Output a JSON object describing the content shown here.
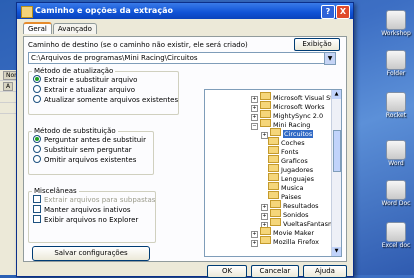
{
  "dialog": {
    "title": "Caminho e opções da extração",
    "help_button": "?",
    "close_button": "X"
  },
  "tabs": [
    {
      "label": "Geral",
      "active": true
    },
    {
      "label": "Avançado",
      "active": false
    }
  ],
  "destination": {
    "label": "Caminho de destino (se o caminho não existir, ele será criado)",
    "value": "C:\\Arquivos de programas\\Mini Racing\\Circuitos",
    "explore_button": "Exibição"
  },
  "update_method": {
    "title": "Método de atualização",
    "options": [
      {
        "label": "Extrair e substituir arquivo",
        "selected": true
      },
      {
        "label": "Extrair e atualizar arquivo",
        "selected": false
      },
      {
        "label": "Atualizar somente arquivos existentes",
        "selected": false
      }
    ]
  },
  "overwrite_mode": {
    "title": "Método de substituição",
    "options": [
      {
        "label": "Perguntar antes de substituir",
        "selected": true
      },
      {
        "label": "Substituir sem perguntar",
        "selected": false
      },
      {
        "label": "Omitir arquivos existentes",
        "selected": false
      }
    ]
  },
  "misc": {
    "title": "Miscelâneas",
    "options": [
      {
        "label": "Extrair arquivos para subpastas",
        "checked": false,
        "disabled": true
      },
      {
        "label": "Manter arquivos inativos",
        "checked": false,
        "disabled": false
      },
      {
        "label": "Exibir arquivos no Explorer",
        "checked": false,
        "disabled": false
      }
    ],
    "save_button": "Salvar configurações"
  },
  "tree": {
    "items": [
      {
        "label": "Microsoft Visual Studio",
        "expandable": true,
        "depth": 0
      },
      {
        "label": "Microsoft Works",
        "expandable": true,
        "depth": 0
      },
      {
        "label": "MightySync 2.0",
        "expandable": true,
        "depth": 0
      },
      {
        "label": "Mini Racing",
        "expandable": true,
        "depth": 0
      },
      {
        "label": "Circuitos",
        "expandable": true,
        "depth": 1,
        "selected": true
      },
      {
        "label": "Coches",
        "expandable": false,
        "depth": 1
      },
      {
        "label": "Fonts",
        "expandable": false,
        "depth": 1
      },
      {
        "label": "Graficos",
        "expandable": false,
        "depth": 1
      },
      {
        "label": "Jugadores",
        "expandable": false,
        "depth": 1
      },
      {
        "label": "Lenguajes",
        "expandable": false,
        "depth": 1
      },
      {
        "label": "Musica",
        "expandable": false,
        "depth": 1
      },
      {
        "label": "Paises",
        "expandable": false,
        "depth": 1
      },
      {
        "label": "Resultados",
        "expandable": true,
        "depth": 1
      },
      {
        "label": "Sonidos",
        "expandable": true,
        "depth": 1
      },
      {
        "label": "VueltasFantasma",
        "expandable": true,
        "depth": 1
      },
      {
        "label": "Movie Maker",
        "expandable": true,
        "depth": 0
      },
      {
        "label": "Mozilla Firefox",
        "expandable": true,
        "depth": 0
      }
    ]
  },
  "footer": {
    "ok": "OK",
    "cancel": "Cancelar",
    "help": "Ajuda"
  },
  "background_window": {
    "rows": [
      "Nom",
      "A",
      "",
      ""
    ]
  },
  "desktop_icons": [
    {
      "label": "Workshop",
      "icon": "folder-icon"
    },
    {
      "label": "Folder",
      "icon": "folder-icon"
    },
    {
      "label": "Rocket",
      "icon": "recycle-icon"
    },
    {
      "label": "Word",
      "icon": "word-doc-icon"
    },
    {
      "label": "Word Doc",
      "icon": "word-doc-icon"
    },
    {
      "label": "Excel doc",
      "icon": "excel-doc-icon"
    }
  ]
}
